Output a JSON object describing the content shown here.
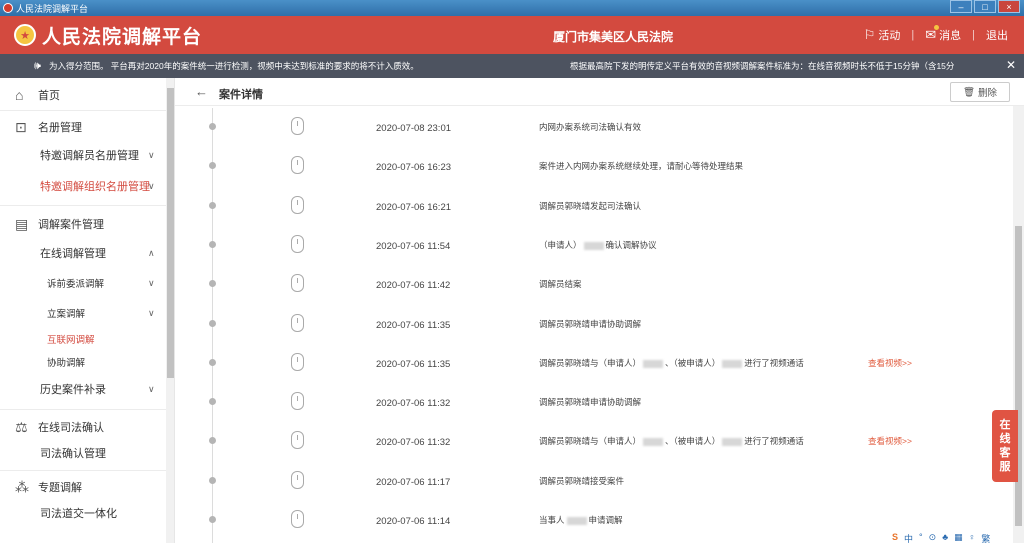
{
  "window": {
    "title": "人民法院调解平台",
    "buttons": [
      "–",
      "□",
      "×"
    ]
  },
  "header": {
    "brand": "人民法院调解平台",
    "court": "厦门市集美区人民法院",
    "activity": "活动",
    "messages": "消息",
    "logout": "退出"
  },
  "notice": {
    "left": "为入得分范围。 平台再对2020年的案件统一进行检测，视频中未达到标准的要求的将不计入质效。",
    "right": "根据最高院下发的明传定义平台有效的音视频调解案件标准为：在线音视频时长不低于15分钟（含15分"
  },
  "sidebar": {
    "home": "首页",
    "roster": "名册管理",
    "roster_items": [
      "特邀调解员名册管理",
      "特邀调解组织名册管理"
    ],
    "case_mgmt": "调解案件管理",
    "online_mgmt": "在线调解管理",
    "online_items": [
      "诉前委派调解",
      "立案调解",
      "互联网调解",
      "协助调解"
    ],
    "history": "历史案件补录",
    "judicial": "在线司法确认",
    "judicial_item": "司法确认管理",
    "special": "专题调解",
    "special_item": "司法道交一体化"
  },
  "main": {
    "title": "案件详情",
    "delete": "删除",
    "link_label": "查看视频>>",
    "events": [
      {
        "time": "2020-07-08 23:01",
        "pre": "内网办案系统司法确认有效",
        "post": ""
      },
      {
        "time": "2020-07-06 16:23",
        "pre": "案件进入内网办案系统继续处理，请耐心等待处理结果",
        "post": ""
      },
      {
        "time": "2020-07-06 16:21",
        "pre": "调解员郭晓靖发起司法确认",
        "post": ""
      },
      {
        "time": "2020-07-06 11:54",
        "pre": "（申请人）",
        "post": "确认调解协议"
      },
      {
        "time": "2020-07-06 11:42",
        "pre": "调解员结案",
        "post": ""
      },
      {
        "time": "2020-07-06 11:35",
        "pre": "调解员郭晓靖申请协助调解",
        "post": ""
      },
      {
        "time": "2020-07-06 11:35",
        "pre": "调解员郭晓靖与（申请人）",
        "mid": "、（被申请人）",
        "post": "进行了视频通话",
        "link": true
      },
      {
        "time": "2020-07-06 11:32",
        "pre": "调解员郭晓靖申请协助调解",
        "post": ""
      },
      {
        "time": "2020-07-06 11:32",
        "pre": "调解员郭晓靖与（申请人）",
        "mid": "、（被申请人）",
        "post": "进行了视频通话",
        "link": true
      },
      {
        "time": "2020-07-06 11:17",
        "pre": "调解员郭晓靖接受案件",
        "post": ""
      },
      {
        "time": "2020-07-06 11:14",
        "pre": "当事人",
        "post": "申请调解"
      }
    ]
  },
  "service": [
    "在",
    "线",
    "客",
    "服"
  ],
  "tray": [
    "S",
    "中",
    "°",
    "⊙",
    "♣",
    "▦",
    "♀",
    "繁"
  ],
  "colors": {
    "header": "#d34a3f",
    "notice": "#4d5360",
    "accent": "#e05a3c"
  }
}
